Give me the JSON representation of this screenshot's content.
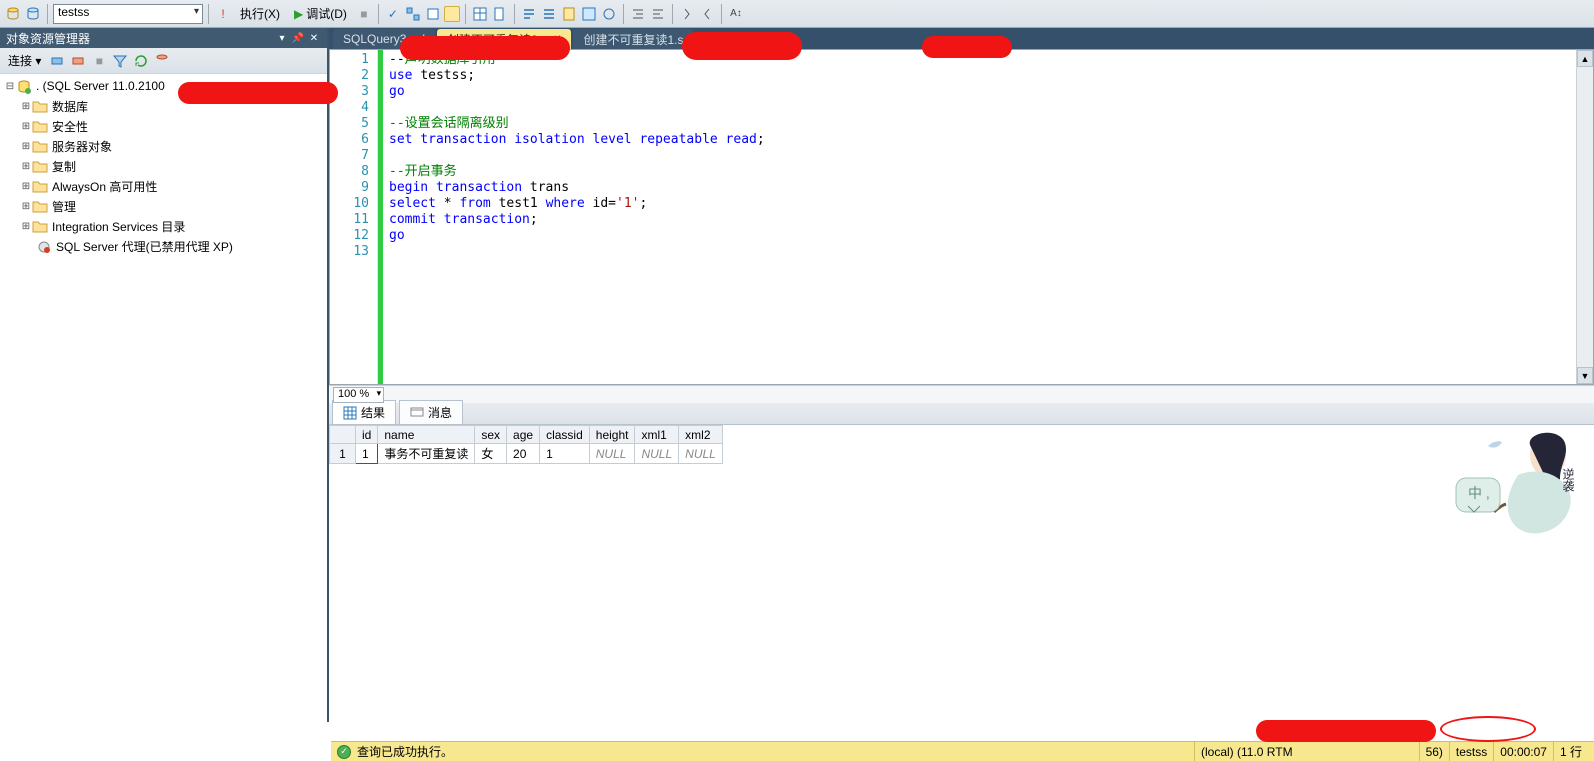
{
  "toolbar": {
    "combo_value": "testss",
    "execute_label": "执行(X)",
    "debug_label": "调试(D)"
  },
  "panel": {
    "title": "对象资源管理器",
    "connect_label": "连接 ▾",
    "root": ". (SQL Server 11.0.2100",
    "nodes": [
      "数据库",
      "安全性",
      "服务器对象",
      "复制",
      "AlwaysOn 高可用性",
      "管理",
      "Integration Services 目录"
    ],
    "agent": "SQL Server 代理(已禁用代理 XP)"
  },
  "tabs": [
    {
      "label": "SQLQuery3.sql",
      "active": false
    },
    {
      "label": "创建不可重复读2.s",
      "active": true
    },
    {
      "label": "创建不可重复读1.s",
      "active": false
    }
  ],
  "code_lines": [
    {
      "n": 1,
      "html": "<span class='ident'>--</span><span class='cmt'>声明数据库引用</span>"
    },
    {
      "n": 2,
      "html": "<span class='kw'>use</span> <span class='ident'>testss</span>;"
    },
    {
      "n": 3,
      "html": "<span class='kw'>go</span>"
    },
    {
      "n": 4,
      "html": ""
    },
    {
      "n": 5,
      "html": "<span class='cmt'>--设置会话隔离级别</span>"
    },
    {
      "n": 6,
      "html": "<span class='kw'>set transaction isolation level repeatable read</span>;"
    },
    {
      "n": 7,
      "html": ""
    },
    {
      "n": 8,
      "html": "<span class='cmt'>--开启事务</span>"
    },
    {
      "n": 9,
      "html": "<span class='kw'>begin transaction</span> <span class='ident'>trans</span>"
    },
    {
      "n": 10,
      "html": "<span class='kw'>select</span> * <span class='kw'>from</span> test1 <span class='kw'>where</span> id=<span class='str'>'1'</span>;"
    },
    {
      "n": 11,
      "html": "<span class='kw'>commit transaction</span>;"
    },
    {
      "n": 12,
      "html": "<span class='kw'>go</span>"
    },
    {
      "n": 13,
      "html": ""
    }
  ],
  "zoom": "100 %",
  "result_tabs": {
    "results": "结果",
    "messages": "消息"
  },
  "grid": {
    "headers": [
      "id",
      "name",
      "sex",
      "age",
      "classid",
      "height",
      "xml1",
      "xml2"
    ],
    "rows": [
      {
        "n": "1",
        "cells": [
          "1",
          "事务不可重复读",
          "女",
          "20",
          "1",
          "NULL",
          "NULL",
          "NULL"
        ]
      }
    ]
  },
  "status": {
    "ok": "查询已成功执行。",
    "server": "(local) (11.0 RTM",
    "tail": "56)",
    "db": "testss",
    "elapsed": "00:00:07",
    "rows": "1 行"
  }
}
